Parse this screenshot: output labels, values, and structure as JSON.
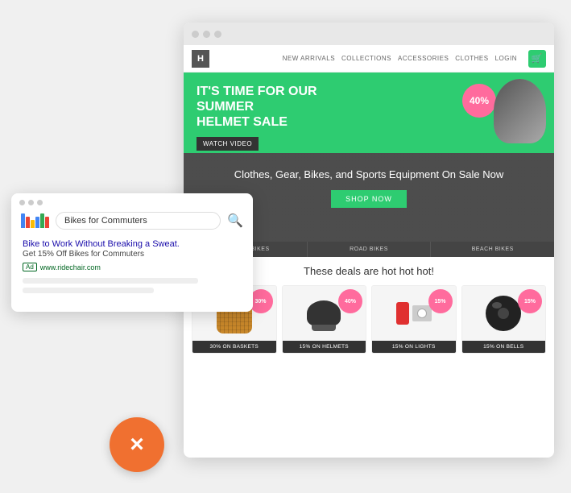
{
  "browser": {
    "dots": [
      "dot1",
      "dot2",
      "dot3"
    ]
  },
  "site": {
    "logo": "H",
    "nav_links": [
      "NEW ARRIVALS",
      "COLLECTIONS",
      "ACCESSORIES",
      "CLOTHES",
      "LOGIN"
    ],
    "hero": {
      "title_line1": "It's Time for Our SUMMER",
      "title_line2": "HELMET SALE",
      "watch_video_label": "WATCH VIDEO",
      "badge": "40%"
    },
    "second_banner": {
      "title": "Clothes, Gear, Bikes, and Sports Equipment On Sale Now",
      "shop_now_label": "SHOP NOW"
    },
    "category_tabs": [
      "CRUISER BIKES",
      "ROAD BIKES",
      "BEACH BIKES"
    ],
    "deals_title": "These deals are hot hot hot!",
    "deals": [
      {
        "badge": "30%",
        "label": "30% ON BASKETS",
        "type": "basket"
      },
      {
        "badge": "40%",
        "label": "15% ON HELMETS",
        "type": "helmet"
      },
      {
        "badge": "15%",
        "label": "15% ON LIGHTS",
        "type": "lights"
      },
      {
        "badge": "15%",
        "label": "15% ON BELLS",
        "type": "bell"
      }
    ]
  },
  "search_card": {
    "query": "Bikes for Commuters",
    "ad_headline": "Bike to Work Without Breaking a Sweat.",
    "ad_description": "Get 15% Off Bikes for Commuters",
    "ad_badge": "Ad",
    "ad_url": "www.ridechair.com"
  },
  "close_button": {
    "label": "×"
  },
  "colors": {
    "green": "#2ecc71",
    "pink": "#ff6b9d",
    "orange": "#f07030",
    "dark": "#333"
  }
}
